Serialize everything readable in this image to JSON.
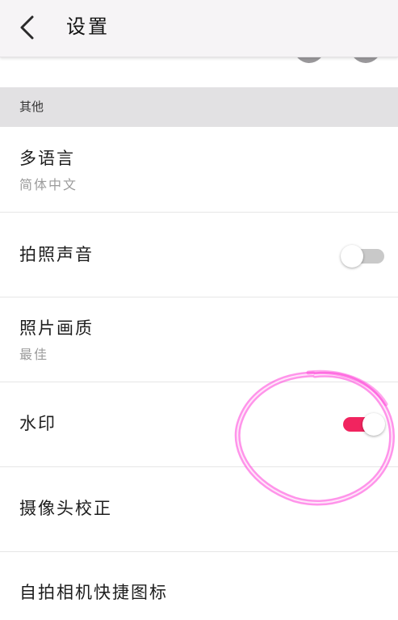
{
  "header": {
    "title": "设置"
  },
  "section": {
    "title": "其他"
  },
  "items": [
    {
      "label": "多语言",
      "sub": "简体中文"
    },
    {
      "label": "拍照声音",
      "toggle": false
    },
    {
      "label": "照片画质",
      "sub": "最佳"
    },
    {
      "label": "水印",
      "toggle": true
    },
    {
      "label": "摄像头校正"
    },
    {
      "label": "自拍相机快捷图标"
    }
  ],
  "colors": {
    "accent": "#f1245f",
    "annotation": "#ff3dd8",
    "section_bg": "#e2e1e3"
  }
}
